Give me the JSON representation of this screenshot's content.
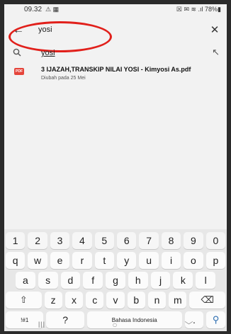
{
  "status": {
    "time": "09.32",
    "left_icons": "⚠ ▦",
    "right": "☒ ✉ ≋ .ıl 78%▮"
  },
  "search": {
    "query": "yosi",
    "suggestion": "yosi"
  },
  "result": {
    "pdf_badge": "PDF",
    "title": "3 IJAZAH,TRANSKIP NILAI YOSI - Kimyosi As.pdf",
    "subtitle": "Diubah pada 25 Mei"
  },
  "keyboard": {
    "row0": [
      "1",
      "2",
      "3",
      "4",
      "5",
      "6",
      "7",
      "8",
      "9",
      "0"
    ],
    "row1": [
      "q",
      "w",
      "e",
      "r",
      "t",
      "y",
      "u",
      "i",
      "o",
      "p"
    ],
    "row2": [
      "a",
      "s",
      "d",
      "f",
      "g",
      "h",
      "j",
      "k",
      "l"
    ],
    "row3": [
      "z",
      "x",
      "c",
      "v",
      "b",
      "n",
      "m"
    ],
    "symbols": "!#1",
    "question": "?",
    "space": "Bahasa Indonesia",
    "dot": "."
  },
  "nav": {
    "recents": "III",
    "home": "○",
    "back": "﹀"
  },
  "colors": {
    "accent": "#e1201b",
    "pdf": "#e5453b"
  }
}
